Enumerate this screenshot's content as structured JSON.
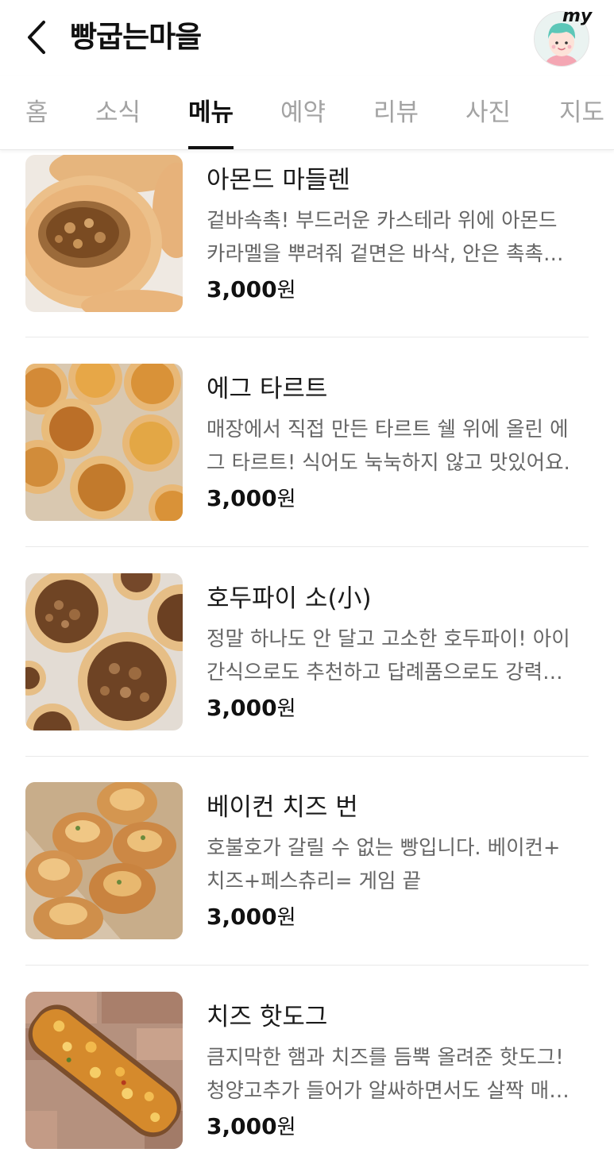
{
  "header": {
    "title": "빵굽는마을",
    "back_icon": "chevron-left-icon",
    "my_label": "my"
  },
  "tabs": [
    {
      "label": "홈",
      "active": false
    },
    {
      "label": "소식",
      "active": false
    },
    {
      "label": "메뉴",
      "active": true
    },
    {
      "label": "예약",
      "active": false
    },
    {
      "label": "리뷰",
      "active": false
    },
    {
      "label": "사진",
      "active": false
    },
    {
      "label": "지도",
      "active": false
    }
  ],
  "menu": [
    {
      "name": "아몬드 마들렌",
      "desc_line1": "겉바속촉! 부드러운 카스테라 위에 아몬드",
      "desc_line2": "카라멜을 뿌려줘 겉면은 바삭, 안은 촉촉…",
      "price": "3,000",
      "currency": "원"
    },
    {
      "name": "에그 타르트",
      "desc_line1": "매장에서 직접 만든 타르트 쉘 위에 올린 에",
      "desc_line2": "그 타르트! 식어도 눅눅하지 않고 맛있어요.",
      "price": "3,000",
      "currency": "원"
    },
    {
      "name": "호두파이 소(小)",
      "desc_line1": "정말 하나도 안 달고 고소한 호두파이! 아이",
      "desc_line2": "간식으로도 추천하고 답례품으로도 강력…",
      "price": "3,000",
      "currency": "원"
    },
    {
      "name": "베이컨 치즈 번",
      "desc_line1": "호불호가 갈릴 수 없는 빵입니다. 베이컨+",
      "desc_line2": "치즈+페스츄리= 게임 끝",
      "price": "3,000",
      "currency": "원"
    },
    {
      "name": "치즈 핫도그",
      "desc_line1": "큼지막한 햄과 치즈를 듬뿍 올려준 핫도그!",
      "desc_line2": "청양고추가 들어가 알싸하면서도 살짝 매…",
      "price": "3,000",
      "currency": "원"
    }
  ]
}
